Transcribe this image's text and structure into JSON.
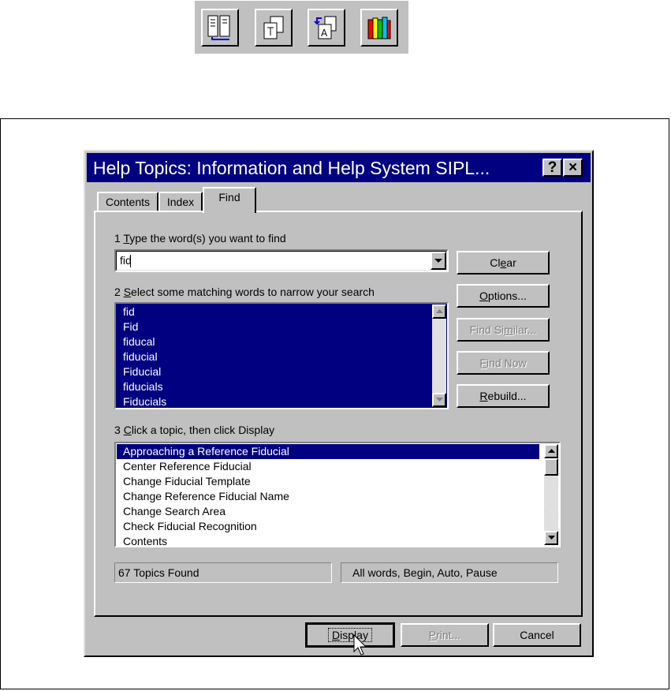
{
  "toolbar": {
    "icons": [
      "contents-layout-icon",
      "topic-window-icon",
      "font-substitute-icon",
      "books-icon"
    ]
  },
  "dialog": {
    "title": "Help Topics: Information and Help System SIPL...",
    "help_button": "?",
    "close_button": "×",
    "tabs": [
      {
        "label": "Contents"
      },
      {
        "label": "Index"
      },
      {
        "label": "Find"
      }
    ],
    "step1": {
      "num": "1 ",
      "key": "T",
      "rest": "ype the word(s) you want to find"
    },
    "search_value": "fid",
    "step2": {
      "num": "2 ",
      "key": "S",
      "rest": "elect some matching words to narrow your search"
    },
    "words": [
      "fid",
      "Fid",
      "fiducal",
      "fiducial",
      "Fiducial",
      "fiducials",
      "Fiducials"
    ],
    "step3": {
      "num": "3 ",
      "key": "C",
      "rest": "lick a topic, then click Display"
    },
    "topics": [
      "Approaching a Reference Fiducial",
      "Center Reference Fiducial",
      "Change Fiducial Template",
      "Change Reference Fiducial Name",
      "Change Search Area",
      "Check Fiducial Recognition",
      "Contents"
    ],
    "buttons": {
      "clear": {
        "pre": "Cl",
        "key": "e",
        "post": "ar"
      },
      "options": {
        "pre": "",
        "key": "O",
        "post": "ptions..."
      },
      "find_similar": {
        "pre": "Find Si",
        "key": "m",
        "post": "ilar..."
      },
      "find_now": {
        "pre": "",
        "key": "F",
        "post": "ind Now"
      },
      "rebuild": {
        "pre": "",
        "key": "R",
        "post": "ebuild..."
      }
    },
    "status_count": "67 Topics Found",
    "status_options": "All words, Begin, Auto, Pause",
    "bottom_buttons": {
      "display": {
        "pre": "",
        "key": "D",
        "post": "isplay"
      },
      "print": {
        "pre": "",
        "key": "P",
        "post": "rint..."
      },
      "cancel": "Cancel"
    }
  },
  "colors": {
    "titlebar": "#000080",
    "face": "#c0c0c0",
    "selection": "#000080"
  }
}
